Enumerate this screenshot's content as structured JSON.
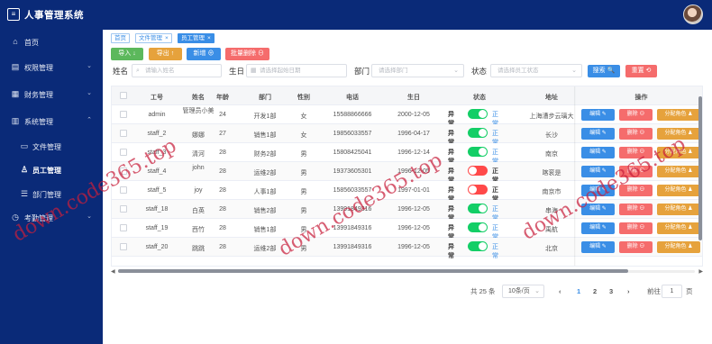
{
  "app": {
    "title": "人事管理系统",
    "logo_icon": "app-logo-icon",
    "avatar_icon": "user-avatar"
  },
  "sidebar": {
    "items": [
      {
        "label": "首页",
        "icon": "home-icon"
      },
      {
        "label": "权限管理",
        "icon": "bank-icon"
      },
      {
        "label": "财务管理",
        "icon": "finance-icon"
      },
      {
        "label": "系统管理",
        "icon": "chart-icon"
      },
      {
        "label": "文件管理",
        "icon": "folder-icon"
      },
      {
        "label": "员工管理",
        "icon": "person-icon"
      },
      {
        "label": "部门管理",
        "icon": "list-icon"
      },
      {
        "label": "考勤管理",
        "icon": "clock-icon"
      }
    ]
  },
  "tabs": [
    {
      "label": "首页"
    },
    {
      "label": "文件管理",
      "close": "×"
    },
    {
      "label": "员工管理",
      "close": "×"
    }
  ],
  "toolbar": {
    "import": "导入 ↓",
    "export": "导出 ↑",
    "add": "新增 ⊕",
    "batch_delete": "批量删除 ⊖"
  },
  "filters": {
    "name_label": "姓名",
    "name_placeholder": "请输入姓名",
    "birthday_label": "生日",
    "birthday_placeholder": "请选择起始日期",
    "dept_label": "部门",
    "dept_placeholder": "请选择部门",
    "status_label": "状态",
    "status_placeholder": "请选择员工状态",
    "search_button": "搜索 🔍",
    "reset_button": "重置 ⟲"
  },
  "table": {
    "headers": [
      "工号",
      "姓名",
      "年龄",
      "部门",
      "性别",
      "电话",
      "生日",
      "状态",
      "地址",
      "操作"
    ],
    "switch_off_label": "异常",
    "switch_on_label": "正常",
    "action_edit": "编辑 ✎",
    "action_delete": "删除 ⊖",
    "action_role": "分配角色 ♟",
    "rows": [
      {
        "id": "admin",
        "name": "管理员小美",
        "age": "24",
        "dept": "开发1部",
        "gender": "女",
        "phone": "15588866666",
        "birthday": "2000-12-05",
        "status_on": true,
        "address": "上海漕步云璃大"
      },
      {
        "id": "staff_2",
        "name": "娜娜",
        "age": "27",
        "dept": "销售1部",
        "gender": "女",
        "phone": "19856033557",
        "birthday": "1996-04-17",
        "status_on": true,
        "address": "长沙"
      },
      {
        "id": "staff_3",
        "name": "清河",
        "age": "28",
        "dept": "财务2部",
        "gender": "男",
        "phone": "15808425041",
        "birthday": "1996-12-14",
        "status_on": true,
        "address": "南京"
      },
      {
        "id": "staff_4",
        "name": "john",
        "age": "28",
        "dept": "运维2部",
        "gender": "男",
        "phone": "19373605301",
        "birthday": "1996-12-05",
        "status_on": false,
        "address": "喀衮是"
      },
      {
        "id": "staff_5",
        "name": "joy",
        "age": "28",
        "dept": "人事1部",
        "gender": "男",
        "phone": "15856033557",
        "birthday": "1997-01-01",
        "status_on": false,
        "address": "南京市"
      },
      {
        "id": "staff_18",
        "name": "白英",
        "age": "28",
        "dept": "销售2部",
        "gender": "男",
        "phone": "13991849316",
        "birthday": "1996-12-05",
        "status_on": true,
        "address": "串海"
      },
      {
        "id": "staff_19",
        "name": "西竹",
        "age": "28",
        "dept": "销售1部",
        "gender": "男",
        "phone": "13991849316",
        "birthday": "1996-12-05",
        "status_on": true,
        "address": "禹航"
      },
      {
        "id": "staff_20",
        "name": "跳跳",
        "age": "28",
        "dept": "运维2部",
        "gender": "男",
        "phone": "13991849316",
        "birthday": "1996-12-05",
        "status_on": true,
        "address": "北京"
      }
    ]
  },
  "pagination": {
    "total": "共 25 条",
    "page_size": "10条/页",
    "prev": "‹",
    "next": "›",
    "pages": [
      "1",
      "2",
      "3"
    ],
    "current": "1",
    "goto_label": "前往",
    "goto_value": "1",
    "page_unit": "页"
  },
  "watermark": "down.code365.top",
  "colors": {
    "sidebar": "#0a2a78",
    "primary": "#3a8ee6",
    "success": "#5cb85c",
    "warning": "#e6a23c",
    "danger": "#f56c6c",
    "switch_on": "#13ce66",
    "switch_off": "#ff4949"
  }
}
